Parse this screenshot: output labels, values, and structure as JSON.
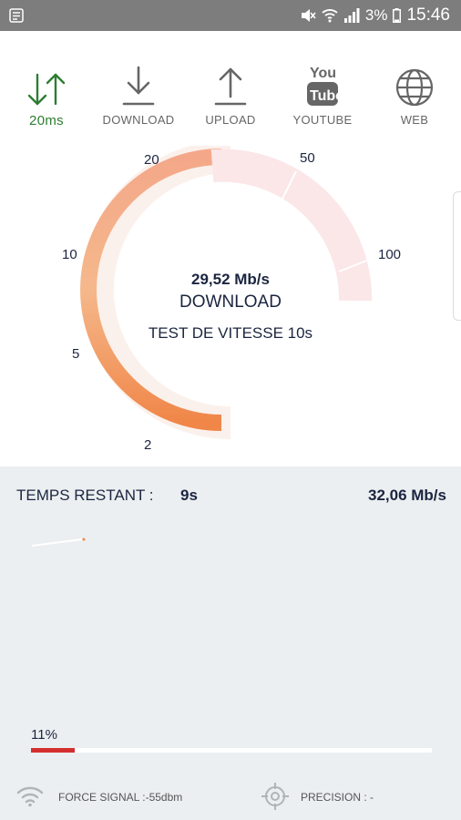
{
  "status_bar": {
    "battery": "3%",
    "time": "15:46"
  },
  "toolbar": {
    "ping_label": "20ms",
    "download_label": "DOWNLOAD",
    "upload_label": "UPLOAD",
    "youtube_label": "YOUTUBE",
    "web_label": "WEB",
    "icons": [
      "ping-arrows-icon",
      "download-icon",
      "upload-icon",
      "youtube-icon",
      "globe-icon"
    ]
  },
  "gauge": {
    "speed": "29,52 Mb/s",
    "mode": "DOWNLOAD",
    "test_label": "TEST DE VITESSE 10s",
    "ticks": [
      "2",
      "5",
      "10",
      "20",
      "50",
      "100"
    ],
    "colors": {
      "active": "#f0894a",
      "inactive": "#fbe9ea"
    }
  },
  "results": {
    "remaining_label": "TEMPS RESTANT :",
    "remaining_value": "9s",
    "current_rate": "32,06 Mb/s"
  },
  "progress": {
    "label": "11%",
    "percent": 11,
    "color": "#d32f2f"
  },
  "footer": {
    "signal_text": "FORCE SIGNAL :-55dbm",
    "precision_text": "PRECISION : -"
  }
}
